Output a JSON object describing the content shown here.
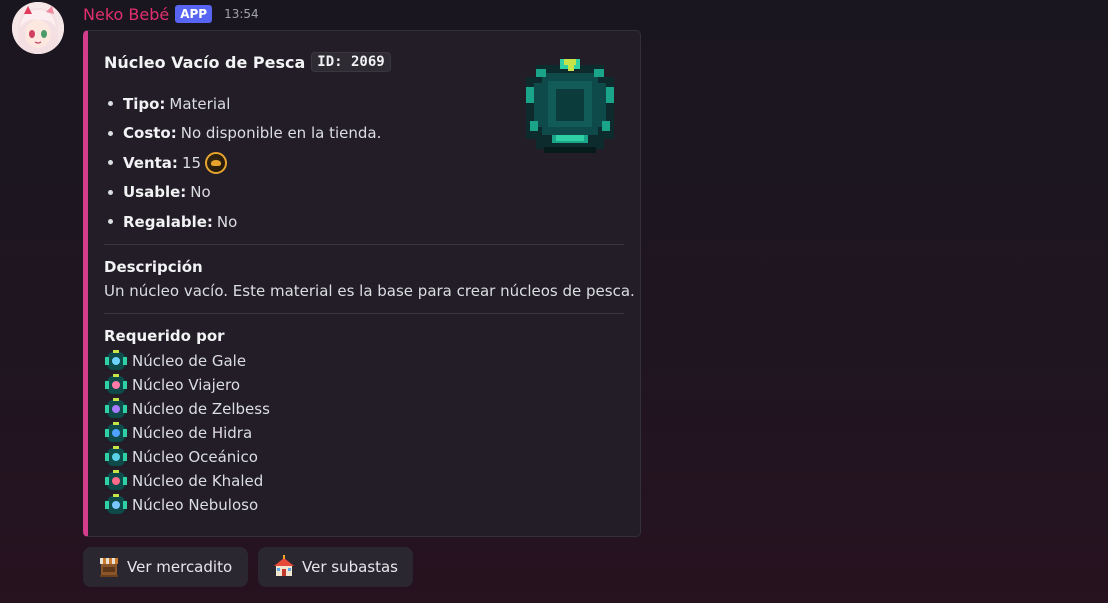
{
  "message": {
    "username": "Neko Bebé",
    "app_badge": "APP",
    "timestamp": "13:54",
    "avatar_icon": "anime-avatar-icon"
  },
  "colors": {
    "username": "#e2306d",
    "badge": "#5865f2",
    "embed_accent": "#d43d8c"
  },
  "embed": {
    "title": "Núcleo Vacío de Pesca",
    "id_code": "ID: 2069",
    "thumbnail_icon": "empty-core-icon",
    "fields": [
      {
        "label": "Tipo:",
        "value": "Material"
      },
      {
        "label": "Costo:",
        "value": "No disponible en la tienda."
      },
      {
        "label": "Venta:",
        "value": "15",
        "icon": "coin-icon"
      },
      {
        "label": "Usable:",
        "value": "No"
      },
      {
        "label": "Regalable:",
        "value": "No"
      }
    ],
    "description_title": "Descripción",
    "description": "Un núcleo vacío. Este material es la base para crear núcleos de pesca.",
    "required_title": "Requerido por",
    "required_by": [
      {
        "name": "Núcleo de Gale",
        "gem_color": "#6fd3ff"
      },
      {
        "name": "Núcleo Viajero",
        "gem_color": "#ff7aa8"
      },
      {
        "name": "Núcleo de Zelbess",
        "gem_color": "#a77bff"
      },
      {
        "name": "Núcleo de Hidra",
        "gem_color": "#4fa3ff"
      },
      {
        "name": "Núcleo Oceánico",
        "gem_color": "#59d0e6"
      },
      {
        "name": "Núcleo de Khaled",
        "gem_color": "#ff6b8a"
      },
      {
        "name": "Núcleo Nebuloso",
        "gem_color": "#79c7ff"
      }
    ]
  },
  "buttons": [
    {
      "label": "Ver mercadito",
      "icon": "market-stall-icon"
    },
    {
      "label": "Ver subastas",
      "icon": "auction-house-icon"
    }
  ]
}
